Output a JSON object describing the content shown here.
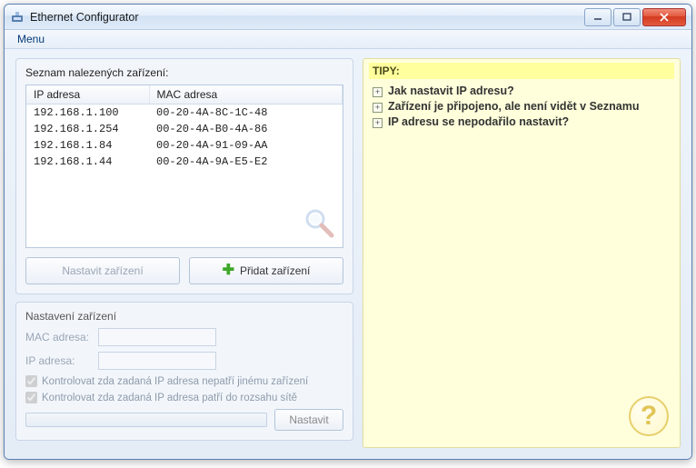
{
  "window": {
    "title": "Ethernet Configurator"
  },
  "menubar": {
    "menu_label": "Menu"
  },
  "devices": {
    "section_title": "Seznam nalezených zařízení:",
    "col_ip": "IP adresa",
    "col_mac": "MAC adresa",
    "rows": [
      {
        "ip": "192.168.1.100",
        "mac": "00-20-4A-8C-1C-48"
      },
      {
        "ip": "192.168.1.254",
        "mac": "00-20-4A-B0-4A-86"
      },
      {
        "ip": "192.168.1.84",
        "mac": "00-20-4A-91-09-AA"
      },
      {
        "ip": "192.168.1.44",
        "mac": "00-20-4A-9A-E5-E2"
      }
    ],
    "btn_configure": "Nastavit zařízení",
    "btn_add": "Přidat zařízení"
  },
  "settings": {
    "section_title": "Nastavení zařízení",
    "mac_label": "MAC adresa:",
    "ip_label": "IP adresa:",
    "check_conflict": "Kontrolovat zda zadaná IP adresa nepatří jinému zařízení",
    "check_range": "Kontrolovat zda zadaná IP adresa patří do rozsahu sítě",
    "btn_set": "Nastavit"
  },
  "tips": {
    "title": "TIPY:",
    "items": [
      "Jak nastavit IP adresu?",
      "Zařízení je připojeno, ale není vidět v Seznamu",
      "IP adresu se nepodařilo nastavit?"
    ]
  }
}
